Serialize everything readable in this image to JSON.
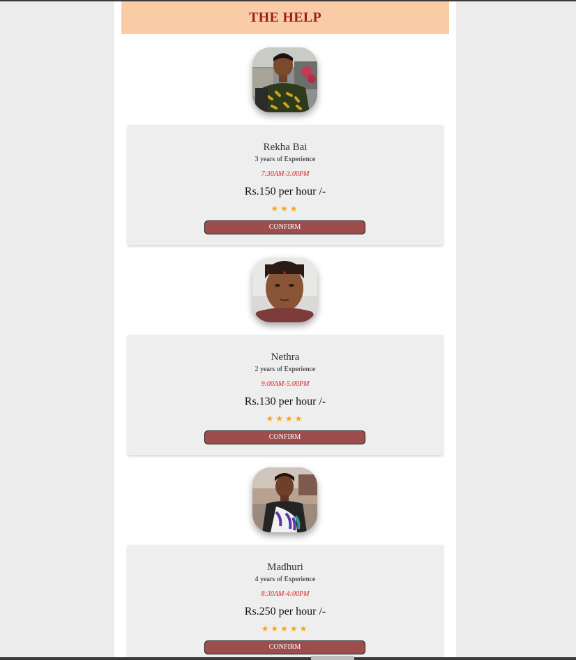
{
  "header": {
    "title": "THE HELP"
  },
  "helpers": [
    {
      "photo": "helper-photo-1",
      "name": "Rekha Bai",
      "experience": "3 years of Experience",
      "hours": "7:30AM-3:00PM",
      "rate": "Rs.150 per hour /-",
      "rating": 3,
      "stars": "★★★",
      "button": "CONFIRM"
    },
    {
      "photo": "helper-photo-2",
      "name": "Nethra",
      "experience": "2 years of Experience",
      "hours": "9:00AM-5:00PM",
      "rate": "Rs.130 per hour /-",
      "rating": 4,
      "stars": "★★★★",
      "button": "CONFIRM"
    },
    {
      "photo": "helper-photo-3",
      "name": "Madhuri",
      "experience": "4 years of Experience",
      "hours": "8:30AM-4:00PM",
      "rate": "Rs.250 per hour /-",
      "rating": 5,
      "stars": "★★★★★",
      "button": "CONFIRM"
    }
  ],
  "colors": {
    "header_bg": "#f9cca5",
    "title": "#a01d1d",
    "hours": "#e21a1a",
    "star": "#f5a623",
    "button": "#9e4d4d",
    "card_bg": "#eeeeee"
  }
}
